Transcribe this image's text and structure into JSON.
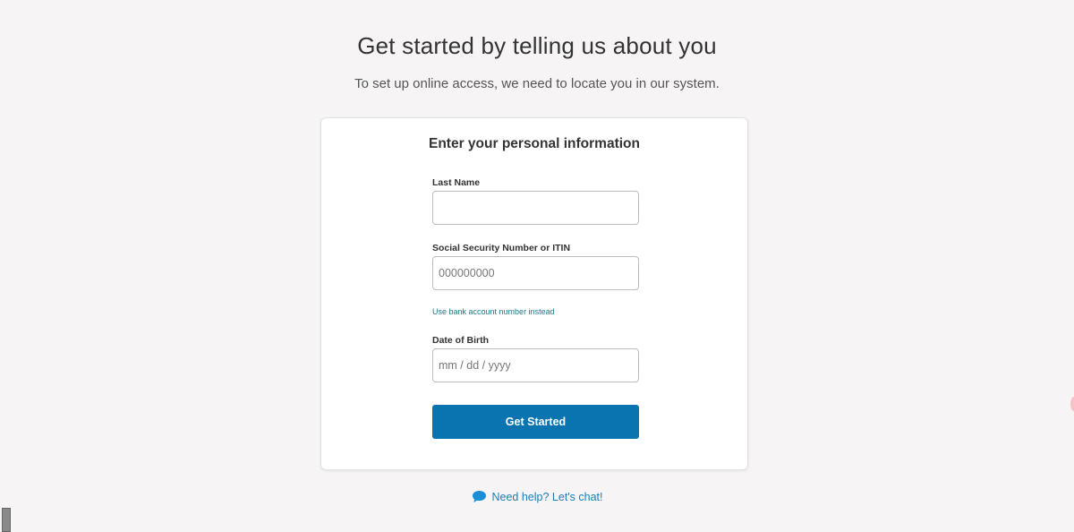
{
  "header": {
    "title": "Get started by telling us about you",
    "subtitle": "To set up online access, we need to locate you in our system."
  },
  "form": {
    "title": "Enter your personal information",
    "last_name": {
      "label": "Last Name",
      "value": "",
      "placeholder": ""
    },
    "ssn": {
      "label": "Social Security Number or ITIN",
      "value": "",
      "placeholder": "000000000"
    },
    "alt_link": "Use bank account number instead",
    "dob": {
      "label": "Date of Birth",
      "value": "",
      "placeholder": "mm / dd / yyyy"
    },
    "submit_label": "Get Started"
  },
  "help": {
    "label": "Need help? Let's chat!",
    "icon": "chat-bubble-icon"
  },
  "colors": {
    "background": "#f6f4f5",
    "primary_button": "#0a74b0",
    "link": "#1c7a8c",
    "help_link": "#1a7fba"
  }
}
